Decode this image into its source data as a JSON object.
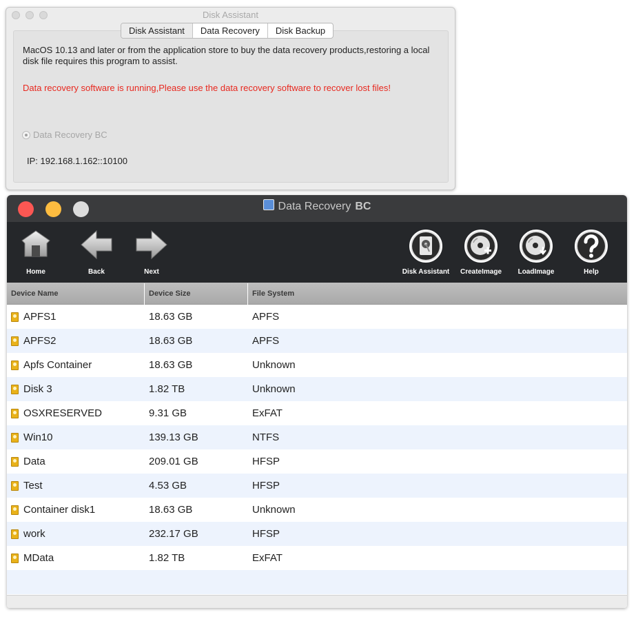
{
  "disk_assistant": {
    "window_title": "Disk Assistant",
    "tabs": [
      {
        "label": "Disk Assistant",
        "active": true
      },
      {
        "label": "Data Recovery",
        "active": false
      },
      {
        "label": "Disk Backup",
        "active": false
      }
    ],
    "description": "MacOS 10.13 and later or from the application store to buy the data recovery products,restoring a local disk file requires this program to assist.",
    "warning": "Data recovery software is running,Please use the data recovery software to recover lost files!",
    "radio_label": "Data Recovery BC",
    "ip_text": "IP: 192.168.1.162::10100",
    "colors": {
      "warning": "#e8281f"
    }
  },
  "data_recovery": {
    "title_main": "Data Recovery",
    "title_suffix": "BC",
    "toolbar": {
      "home": "Home",
      "back": "Back",
      "next": "Next",
      "disk_assistant": "Disk Assistant",
      "create_image": "CreateImage",
      "load_image": "LoadImage",
      "help": "Help"
    },
    "columns": [
      "Device Name",
      "Device Size",
      "File System"
    ],
    "rows": [
      {
        "name": "APFS1",
        "size": "18.63 GB",
        "fs": "APFS"
      },
      {
        "name": "APFS2",
        "size": "18.63 GB",
        "fs": "APFS"
      },
      {
        "name": "Apfs Container",
        "size": "18.63 GB",
        "fs": "Unknown"
      },
      {
        "name": "Disk 3",
        "size": "1.82 TB",
        "fs": "Unknown"
      },
      {
        "name": "OSXRESERVED",
        "size": "9.31 GB",
        "fs": "ExFAT"
      },
      {
        "name": "Win10",
        "size": "139.13 GB",
        "fs": "NTFS"
      },
      {
        "name": "Data",
        "size": "209.01 GB",
        "fs": "HFSP"
      },
      {
        "name": "Test",
        "size": "4.53 GB",
        "fs": "HFSP"
      },
      {
        "name": "Container disk1",
        "size": "18.63 GB",
        "fs": "Unknown"
      },
      {
        "name": "work",
        "size": "232.17 GB",
        "fs": "HFSP"
      },
      {
        "name": "MData",
        "size": "1.82 TB",
        "fs": "ExFAT"
      }
    ],
    "icons": {
      "row": "drive-icon",
      "home": "home-icon",
      "back": "back-arrow-icon",
      "next": "next-arrow-icon",
      "disk_assistant": "hard-drive-icon",
      "create_image": "disc-create-icon",
      "load_image": "disc-load-icon",
      "help": "help-icon"
    },
    "colors": {
      "toolbar": "#25272a",
      "titlebar": "#3a3b3d",
      "row_alt": "#edf3fd",
      "drive_icon": "#e9b21a"
    }
  }
}
